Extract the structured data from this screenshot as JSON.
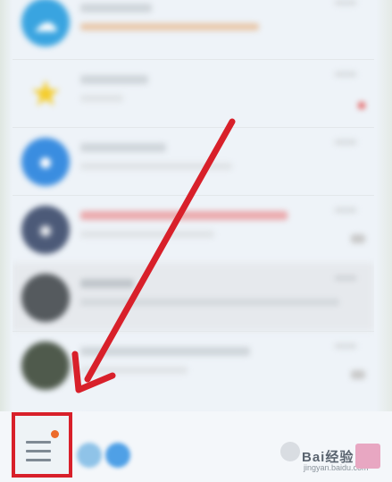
{
  "colors": {
    "annotation_red": "#d8202a",
    "notification_orange": "#ec6a2a"
  },
  "chat_list": [
    {
      "avatar_color": "#39a4e0",
      "icon": "cloud-icon",
      "title": "",
      "preview": "",
      "time": "",
      "badge": ""
    },
    {
      "avatar_color": "#f7d02b",
      "icon": "star-icon",
      "title": "",
      "preview": "",
      "time": "",
      "badge": "unread-dot"
    },
    {
      "avatar_color": "#3a8de0",
      "icon": "phone-icon",
      "title": "",
      "preview": "",
      "time": "",
      "badge": ""
    },
    {
      "avatar_color": "#4c5a78",
      "icon": "group-avatar",
      "title": "",
      "preview": "",
      "time": "",
      "badge": "muted"
    },
    {
      "avatar_color": "#555a5e",
      "icon": "person-avatar",
      "title": "",
      "preview": "",
      "time": "",
      "badge": ""
    },
    {
      "avatar_color": "#4f5a4c",
      "icon": "group-avatar",
      "title": "",
      "preview": "",
      "time": "",
      "badge": "muted"
    }
  ],
  "bottom_nav": {
    "menu_icon": "hamburger-menu-icon",
    "has_notification_dot": true
  },
  "watermark": {
    "brand": "Bai",
    "brand_cn": "经验",
    "sub": "jingyan.baidu.com"
  }
}
